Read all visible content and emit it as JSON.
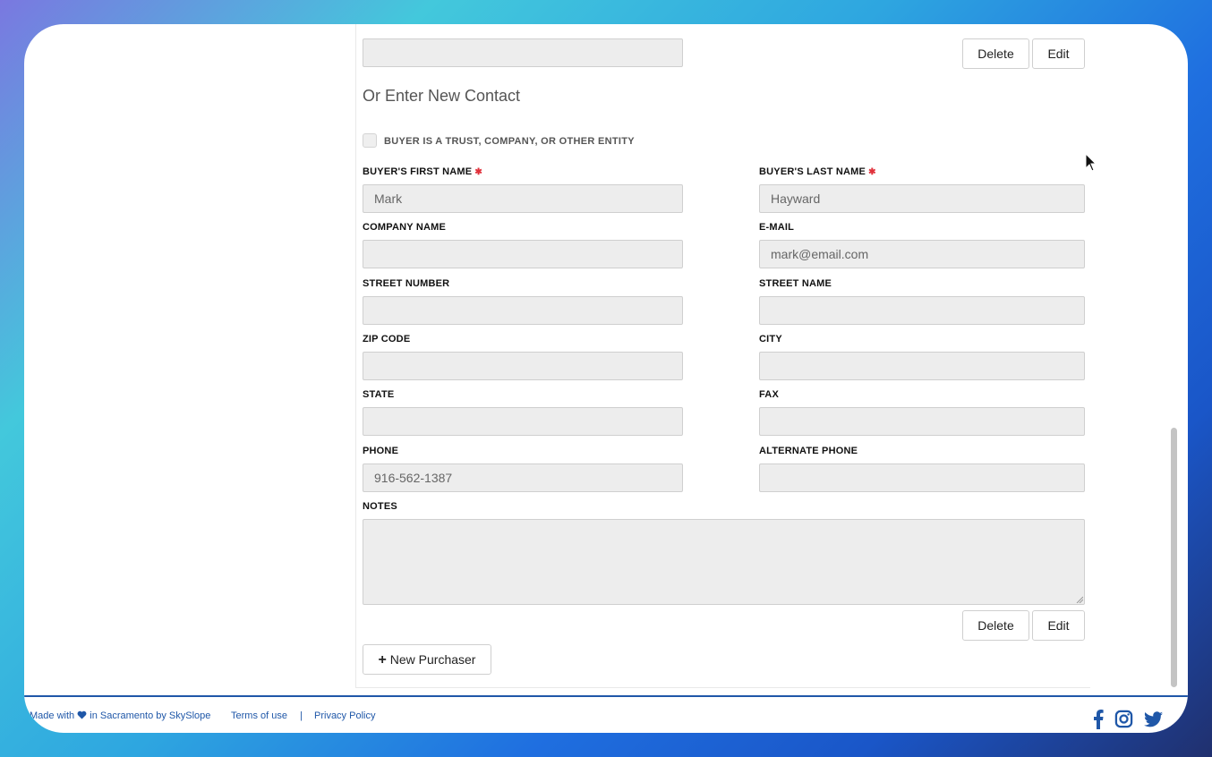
{
  "form": {
    "buttons": {
      "delete": "Delete",
      "edit": "Edit",
      "new_purchaser": "New Purchaser"
    },
    "new_contact_heading": "Or Enter New Contact",
    "entity_checkbox_label": "BUYER IS A TRUST, COMPANY, OR OTHER ENTITY",
    "required_marker": "✱",
    "fields": {
      "first_name": {
        "label": "BUYER'S FIRST NAME",
        "value": "Mark"
      },
      "last_name": {
        "label": "BUYER'S LAST NAME",
        "value": "Hayward"
      },
      "company_name": {
        "label": "COMPANY NAME",
        "value": ""
      },
      "email": {
        "label": "E-MAIL",
        "value": "mark@email.com"
      },
      "street_number": {
        "label": "STREET NUMBER",
        "value": ""
      },
      "street_name": {
        "label": "STREET NAME",
        "value": ""
      },
      "zip_code": {
        "label": "ZIP CODE",
        "value": ""
      },
      "city": {
        "label": "CITY",
        "value": ""
      },
      "state": {
        "label": "STATE",
        "value": ""
      },
      "fax": {
        "label": "FAX",
        "value": ""
      },
      "phone": {
        "label": "PHONE",
        "value": "916-562-1387"
      },
      "alternate_phone": {
        "label": "ALTERNATE PHONE",
        "value": ""
      },
      "notes": {
        "label": "NOTES",
        "value": ""
      }
    }
  },
  "footer": {
    "made_with_prefix": "Made with",
    "made_with_suffix": "in Sacramento by SkySlope",
    "terms": "Terms of use",
    "separator": "|",
    "privacy": "Privacy Policy",
    "social_icons": [
      "facebook-icon",
      "instagram-icon",
      "twitter-icon"
    ]
  },
  "colors": {
    "accent": "#1f57a8",
    "required": "#e0303a"
  }
}
